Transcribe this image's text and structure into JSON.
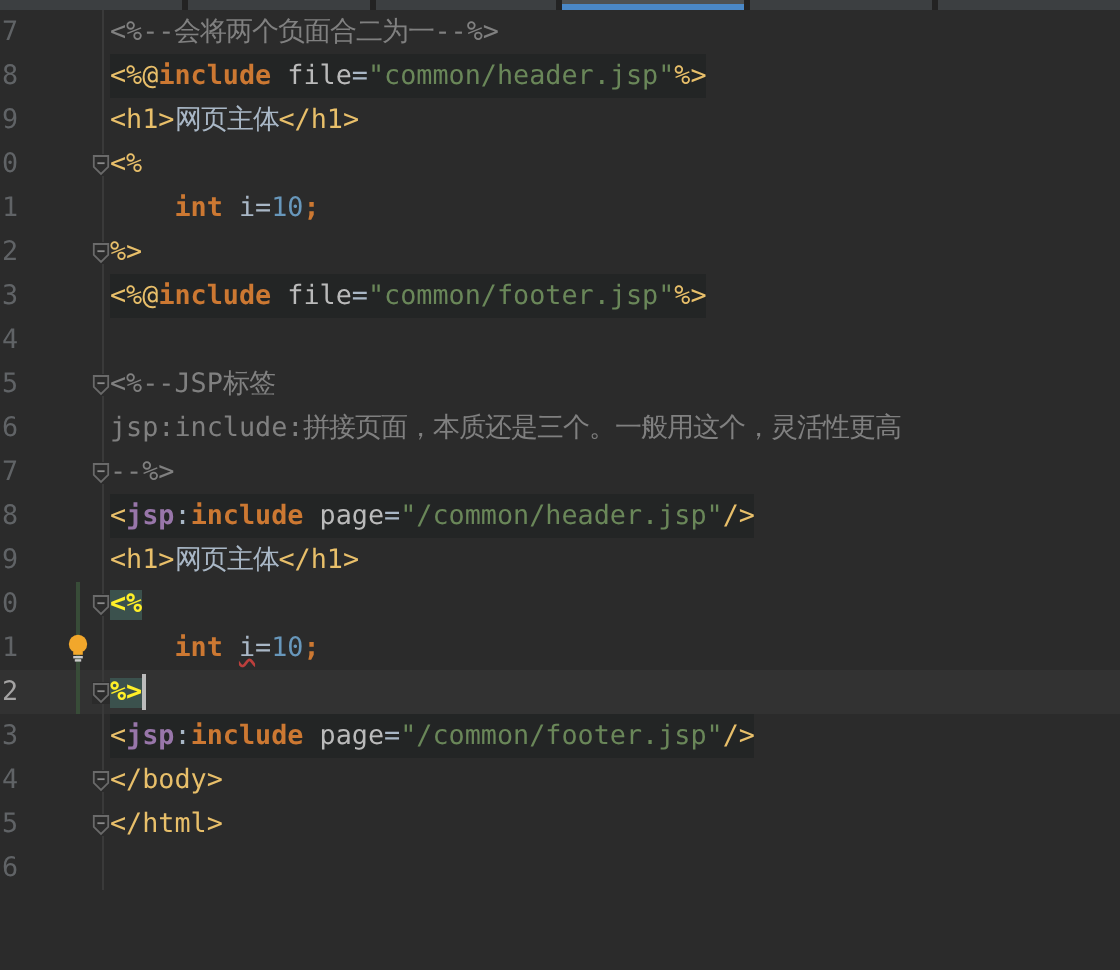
{
  "tabs": [
    {
      "selected": false
    },
    {
      "selected": false
    },
    {
      "selected": false
    },
    {
      "selected": true
    },
    {
      "selected": false
    },
    {
      "selected": false
    }
  ],
  "lines": [
    {
      "number": "7",
      "tokens": [
        {
          "kind": "comment",
          "text": "<%--会将两个负面合二为一--%>"
        }
      ]
    },
    {
      "number": "8",
      "shaded": true,
      "tokens": [
        {
          "kind": "tag",
          "text": "<%@"
        },
        {
          "kind": "keyword",
          "text": "include"
        },
        {
          "kind": "attr",
          "text": "file",
          "spaced": true
        },
        {
          "kind": "plain",
          "text": "="
        },
        {
          "kind": "string",
          "text": "\"common/header.jsp\""
        },
        {
          "kind": "tag",
          "text": "%>"
        }
      ]
    },
    {
      "number": "9",
      "tokens": [
        {
          "kind": "tag",
          "text": "<h1>"
        },
        {
          "kind": "plain",
          "text": "网页主体"
        },
        {
          "kind": "tag",
          "text": "</h1>"
        }
      ]
    },
    {
      "number": "0",
      "fold": true,
      "tokens": [
        {
          "kind": "tag",
          "text": "<%"
        }
      ]
    },
    {
      "number": "1",
      "indent": true,
      "tokens": [
        {
          "kind": "keyword",
          "text": "int"
        },
        {
          "kind": "plain",
          "text": "i=",
          "spaced": true
        },
        {
          "kind": "number",
          "text": "10"
        },
        {
          "kind": "keyword",
          "text": ";"
        }
      ]
    },
    {
      "number": "2",
      "fold": true,
      "tokens": [
        {
          "kind": "tag",
          "text": "%>"
        }
      ]
    },
    {
      "number": "3",
      "shaded": true,
      "tokens": [
        {
          "kind": "tag",
          "text": "<%@"
        },
        {
          "kind": "keyword",
          "text": "include"
        },
        {
          "kind": "attr",
          "text": "file",
          "spaced": true
        },
        {
          "kind": "plain",
          "text": "="
        },
        {
          "kind": "string",
          "text": "\"common/footer.jsp\""
        },
        {
          "kind": "tag",
          "text": "%>"
        }
      ]
    },
    {
      "number": "4"
    },
    {
      "number": "5",
      "fold": true,
      "tokens": [
        {
          "kind": "comment",
          "text": "<%--JSP标签"
        }
      ]
    },
    {
      "number": "6",
      "tokens": [
        {
          "kind": "comment",
          "text": "jsp:include:拼接页面，本质还是三个。一般用这个，灵活性更高"
        }
      ]
    },
    {
      "number": "7",
      "fold": true,
      "tokens": [
        {
          "kind": "comment",
          "text": "--%>"
        }
      ]
    },
    {
      "number": "8",
      "shaded": true,
      "tokens": [
        {
          "kind": "tag",
          "text": "<"
        },
        {
          "kind": "ns",
          "text": "jsp"
        },
        {
          "kind": "plain",
          "text": ":"
        },
        {
          "kind": "keyword",
          "text": "include"
        },
        {
          "kind": "attr",
          "text": "page",
          "spaced": true
        },
        {
          "kind": "plain",
          "text": "="
        },
        {
          "kind": "string",
          "text": "\"/common/header.jsp\""
        },
        {
          "kind": "tag",
          "text": "/>"
        }
      ]
    },
    {
      "number": "9",
      "tokens": [
        {
          "kind": "tag",
          "text": "<h1>"
        },
        {
          "kind": "plain",
          "text": "网页主体"
        },
        {
          "kind": "tag",
          "text": "</h1>"
        }
      ]
    },
    {
      "number": "0",
      "fold": true,
      "changed": true,
      "tokens": [
        {
          "kind": "match",
          "text": "<%"
        }
      ]
    },
    {
      "number": "1",
      "changed": true,
      "bulb": true,
      "indent": true,
      "tokens": [
        {
          "kind": "keyword",
          "text": "int"
        },
        {
          "kind": "warn",
          "text": "i",
          "spaced": true
        },
        {
          "kind": "plain",
          "text": "="
        },
        {
          "kind": "number",
          "text": "10"
        },
        {
          "kind": "keyword",
          "text": ";"
        }
      ]
    },
    {
      "number": "2",
      "fold": true,
      "changed": true,
      "current": true,
      "tokens": [
        {
          "kind": "match",
          "text": "%>"
        }
      ]
    },
    {
      "number": "3",
      "shaded": true,
      "tokens": [
        {
          "kind": "tag",
          "text": "<"
        },
        {
          "kind": "ns",
          "text": "jsp"
        },
        {
          "kind": "plain",
          "text": ":"
        },
        {
          "kind": "keyword",
          "text": "include"
        },
        {
          "kind": "attr",
          "text": "page",
          "spaced": true
        },
        {
          "kind": "plain",
          "text": "="
        },
        {
          "kind": "string",
          "text": "\"/common/footer.jsp\""
        },
        {
          "kind": "tag",
          "text": "/>"
        }
      ]
    },
    {
      "number": "4",
      "fold": true,
      "tokens": [
        {
          "kind": "tag",
          "text": "</body>"
        }
      ]
    },
    {
      "number": "5",
      "fold": true,
      "tokens": [
        {
          "kind": "tag",
          "text": "</html>"
        }
      ]
    },
    {
      "number": "6"
    }
  ]
}
